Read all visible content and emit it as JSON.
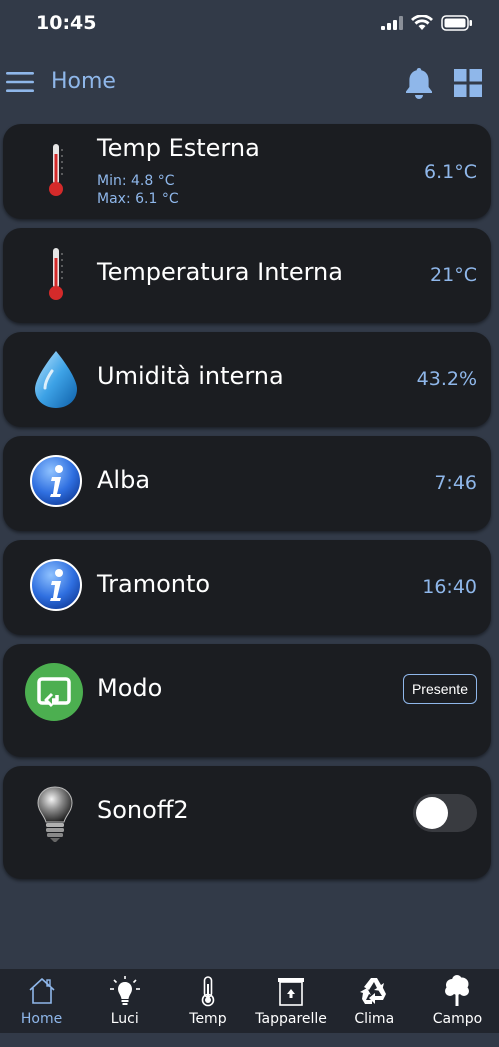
{
  "status_bar": {
    "time": "10:45"
  },
  "header": {
    "title": "Home"
  },
  "cards": {
    "temp_esterna": {
      "title": "Temp Esterna",
      "min": "Min: 4.8 °C",
      "max": "Max: 6.1 °C",
      "value": "6.1°C"
    },
    "temp_interna": {
      "title": "Temperatura Interna",
      "value": "21°C"
    },
    "umidita": {
      "title": "Umidità interna",
      "value": "43.2%"
    },
    "alba": {
      "title": "Alba",
      "value": "7:46"
    },
    "tramonto": {
      "title": "Tramonto",
      "value": "16:40"
    },
    "modo": {
      "title": "Modo",
      "button_label": "Presente"
    },
    "sonoff": {
      "title": "Sonoff2",
      "switch_on": false
    }
  },
  "tabs": [
    {
      "label": "Home",
      "icon": "home-icon",
      "active": true
    },
    {
      "label": "Luci",
      "icon": "bulb-icon"
    },
    {
      "label": "Temp",
      "icon": "thermometer-icon"
    },
    {
      "label": "Tapparelle",
      "icon": "shutter-icon"
    },
    {
      "label": "Clima",
      "icon": "recycle-icon"
    },
    {
      "label": "Campo",
      "icon": "tree-icon"
    }
  ],
  "colors": {
    "background": "#323a48",
    "card": "#1b1d21",
    "accent": "#8fb7ea",
    "tab_bar": "#21252d"
  }
}
